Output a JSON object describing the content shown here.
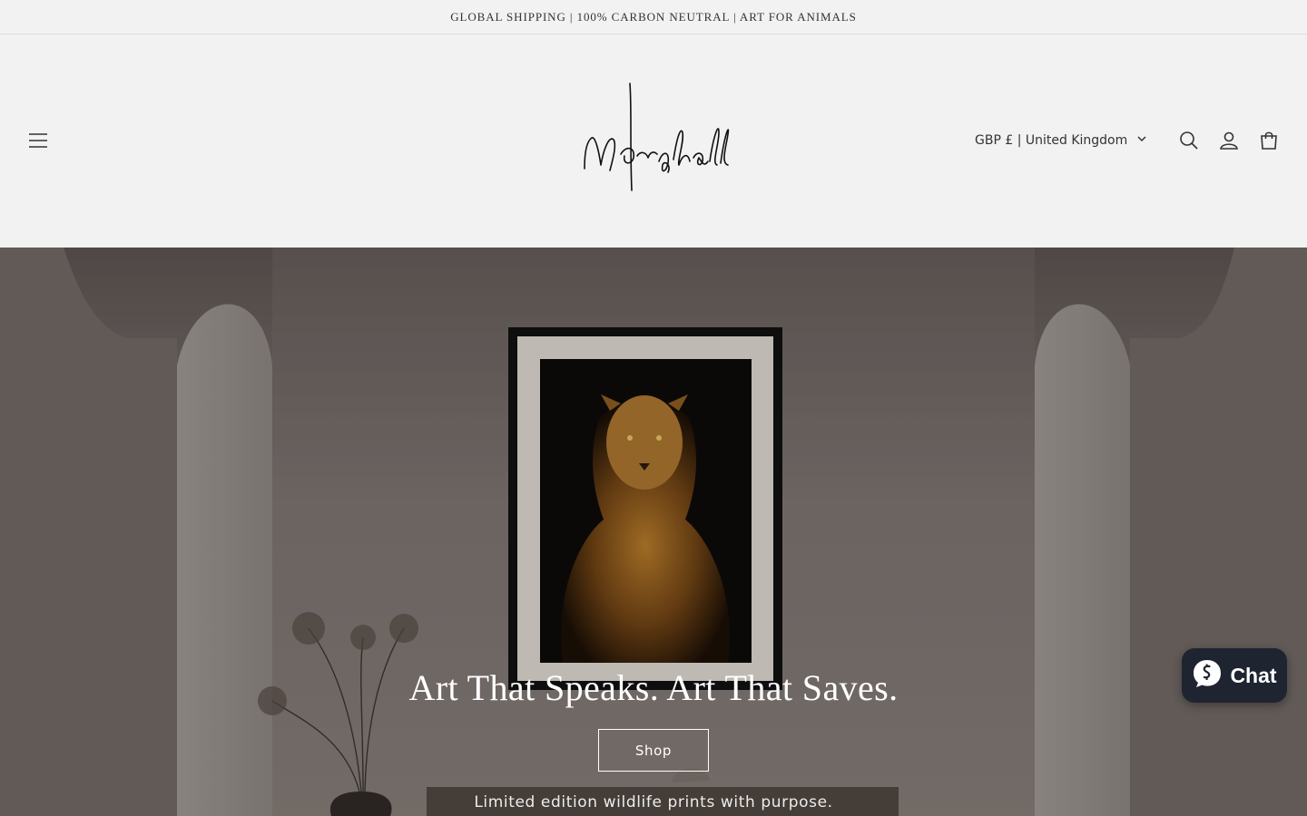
{
  "announcement": {
    "text": "GLOBAL SHIPPING | 100% CARBON NEUTRAL | ART FOR ANIMALS"
  },
  "header": {
    "menu_icon": "hamburger-menu-icon",
    "logo_text": "Marshall",
    "country_selector": {
      "label": "GBP £ | United Kingdom",
      "icon": "chevron-down-icon"
    },
    "icons": [
      "search-icon",
      "account-icon",
      "cart-icon"
    ]
  },
  "hero": {
    "title": "Art That Speaks. Art That Saves.",
    "button_label": "Shop",
    "subtitle": "Limited edition wildlife prints with purpose."
  },
  "chat": {
    "label": "Chat",
    "icon": "shopify-chat-icon",
    "background": "#1e2430"
  },
  "colors": {
    "page_bg": "#f2f2f2",
    "text": "#222222",
    "chat_bg": "#1e2430"
  }
}
